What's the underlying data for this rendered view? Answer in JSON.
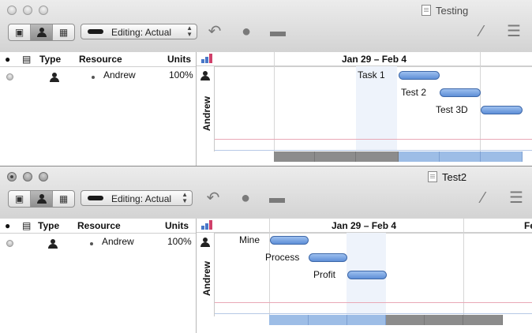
{
  "windows": [
    {
      "id": "testing",
      "title": "Testing",
      "editing_label": "Editing: Actual",
      "columns": {
        "type": "Type",
        "resource": "Resource",
        "units": "Units"
      },
      "rows": [
        {
          "resource": "Andrew",
          "units": "100%"
        }
      ],
      "gantt": {
        "date_range": "Jan 29 – Feb 4",
        "resource_label": "Andrew",
        "tasks": [
          {
            "name": "Task 1"
          },
          {
            "name": "Test 2"
          },
          {
            "name": "Test 3D"
          }
        ]
      }
    },
    {
      "id": "test2",
      "title": "Test2",
      "editing_label": "Editing: Actual",
      "columns": {
        "type": "Type",
        "resource": "Resource",
        "units": "Units"
      },
      "rows": [
        {
          "resource": "Andrew",
          "units": "100%"
        }
      ],
      "gantt": {
        "date_range": "Jan 29 – Feb 4",
        "next_range_partial": "Fe",
        "resource_label": "Andrew",
        "tasks": [
          {
            "name": "Mine"
          },
          {
            "name": "Process"
          },
          {
            "name": "Profit"
          }
        ]
      }
    }
  ],
  "colors": {
    "task_bar": "#6b9be0",
    "highlight": "#eef3fb",
    "pink_line": "#e9a8b6"
  },
  "icons": [
    "comment-icon",
    "note-icon",
    "person-icon",
    "grid-icon",
    "split-icon",
    "assign-icon",
    "level-icon",
    "inspector-icon"
  ]
}
